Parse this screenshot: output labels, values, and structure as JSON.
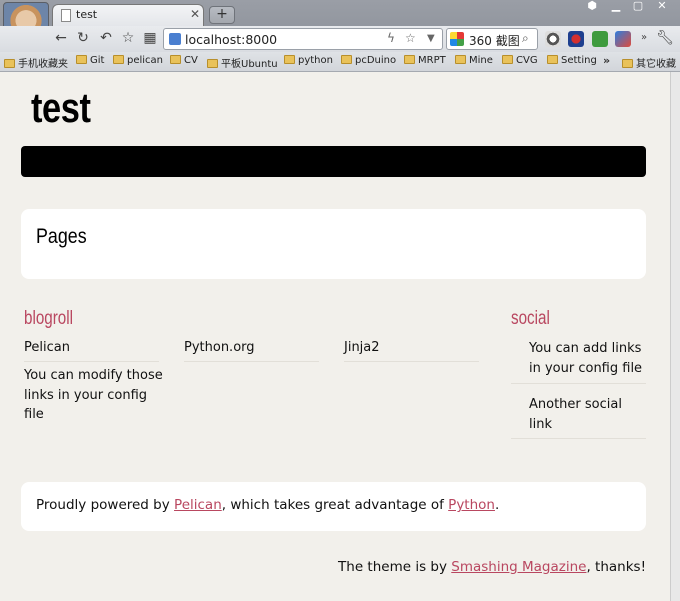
{
  "browser": {
    "tab_title": "test",
    "url": "localhost:8000",
    "search_engine_label": "360 截图",
    "bookmarks": [
      "手机收藏夹",
      "Git",
      "pelican",
      "CV",
      "平板Ubuntu",
      "python",
      "pcDuino",
      "MRPT",
      "Mine",
      "CVG",
      "Setting",
      "其它收藏"
    ],
    "bookmarks_more": "»"
  },
  "site": {
    "title": "test",
    "pages_heading": "Pages"
  },
  "blogroll": {
    "heading": "blogroll",
    "links": [
      "Pelican",
      "Python.org",
      "Jinja2",
      "You can modify those links in your config file"
    ]
  },
  "social": {
    "heading": "social",
    "links": [
      "You can add links in your config file",
      "Another social link"
    ]
  },
  "footer": {
    "prefix": "Proudly powered by ",
    "link1": "Pelican",
    "middle": ", which takes great advantage of ",
    "link2": "Python",
    "suffix": "."
  },
  "credit": {
    "prefix": "The theme is by ",
    "link": "Smashing Magazine",
    "suffix": ", thanks!"
  },
  "colors": {
    "accent": "#b94760",
    "page_bg": "#f2f0eb",
    "menubar": "#000000"
  }
}
